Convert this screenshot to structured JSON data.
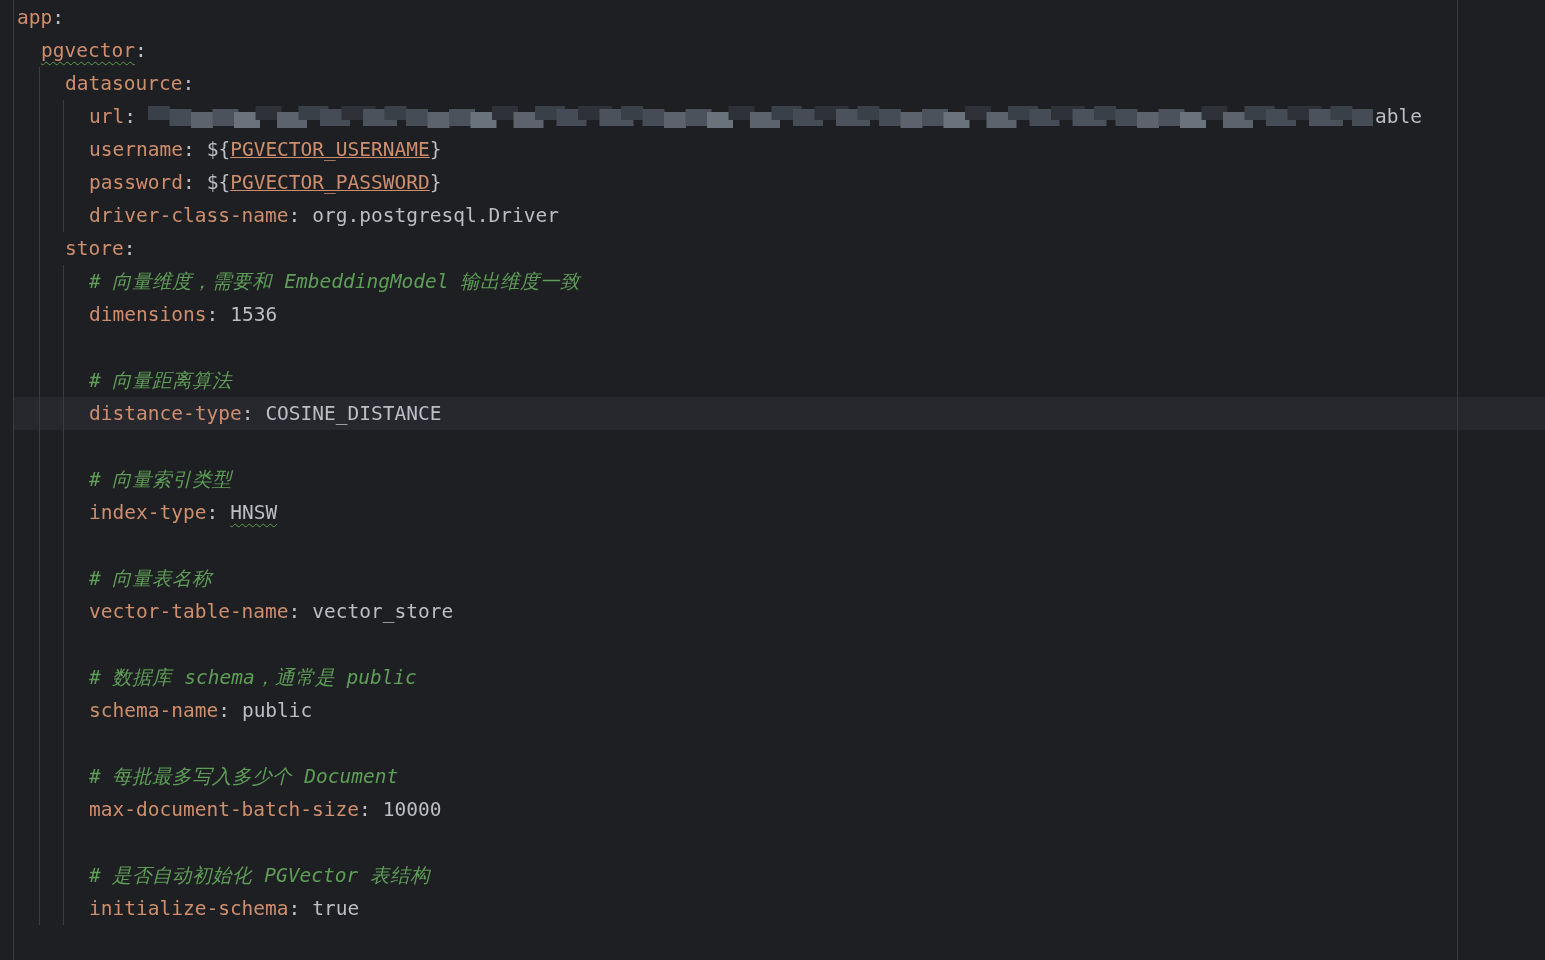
{
  "editor": {
    "tree": [
      {
        "key": "app:",
        "children": [
          {
            "key": "pgvector:",
            "typo": true,
            "children": [
              {
                "key": "datasource:",
                "children": [
                  {
                    "key": "url:",
                    "redacted": true,
                    "value": "able"
                  },
                  {
                    "key": "username:",
                    "value": "${PGVECTOR_USERNAME}",
                    "env": true
                  },
                  {
                    "key": "password:",
                    "value": "${PGVECTOR_PASSWORD}",
                    "env": true
                  },
                  {
                    "key": "driver-class-name:",
                    "value": "org.postgresql.Driver"
                  }
                ]
              },
              {
                "key": "store:",
                "children": [
                  {
                    "key": "dimensions:",
                    "comment": "# 向量维度，需要和 EmbeddingModel 输出维度一致",
                    "value": "1536"
                  },
                  {
                    "key": "distance-type:",
                    "spaced": true,
                    "current": true,
                    "comment": "# 向量距离算法",
                    "value": "COSINE_DISTANCE"
                  },
                  {
                    "key": "index-type:",
                    "spaced": true,
                    "comment": "# 向量索引类型",
                    "value": "HNSW",
                    "typo": true
                  },
                  {
                    "key": "vector-table-name:",
                    "spaced": true,
                    "comment": "# 向量表名称",
                    "value": "vector_store"
                  },
                  {
                    "key": "schema-name:",
                    "spaced": true,
                    "comment": "# 数据库 schema，通常是 public",
                    "value": "public"
                  },
                  {
                    "key": "max-document-batch-size:",
                    "spaced": true,
                    "comment": "# 每批最多写入多少个 Document",
                    "value": "10000"
                  },
                  {
                    "key": "initialize-schema:",
                    "spaced": true,
                    "comment": "# 是否自动初始化 PGVector 表结构",
                    "value": "true"
                  }
                ]
              }
            ]
          }
        ]
      }
    ]
  }
}
